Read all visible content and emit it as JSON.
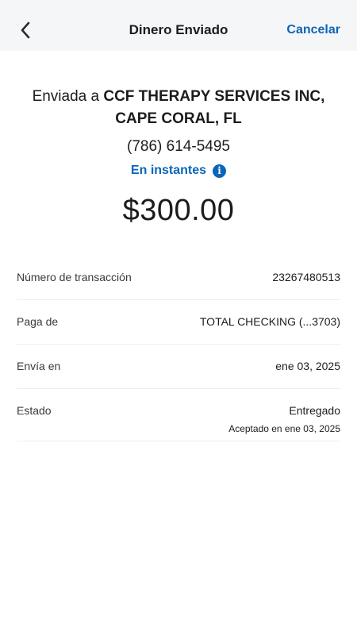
{
  "header": {
    "title": "Dinero Enviado",
    "cancel_label": "Cancelar",
    "back_icon": "chevron-left-icon"
  },
  "summary": {
    "recipient_prefix": "Enviada a ",
    "recipient_name": "CCF THERAPY SERVICES INC, CAPE CORAL, FL",
    "phone": "(786) 614-5495",
    "speed_label": "En instantes",
    "info_icon": "info-icon",
    "amount": "$300.00"
  },
  "details": {
    "transaction": {
      "label": "Número de transacción",
      "value": "23267480513"
    },
    "pay_from": {
      "label": "Paga de",
      "value": "TOTAL CHECKING (...3703)"
    },
    "send_on": {
      "label": "Envía en",
      "value": "ene 03, 2025"
    },
    "status": {
      "label": "Estado",
      "value": "Entregado",
      "sub": "Aceptado en ene 03, 2025"
    }
  },
  "colors": {
    "accent": "#0a66b8",
    "header_bg": "#f5f6f7",
    "divider": "#eeeeee"
  }
}
